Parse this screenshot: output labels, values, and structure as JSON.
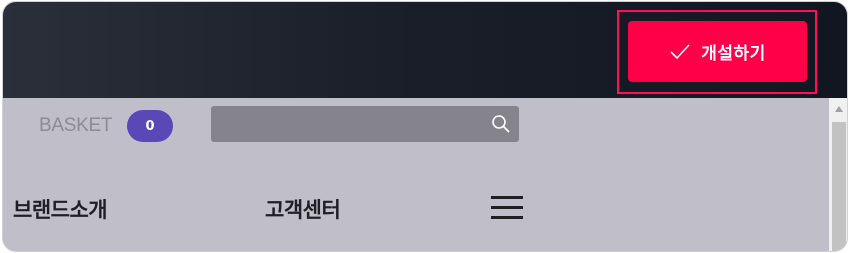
{
  "header": {
    "open_button_label": "개설하기",
    "open_button_icon": "check-icon",
    "accent_color": "#ff0048"
  },
  "basket": {
    "label": "BASKET",
    "count": "0",
    "badge_color": "#5b48b7"
  },
  "search": {
    "value": "",
    "placeholder": "",
    "icon": "search-icon"
  },
  "nav": {
    "items": [
      {
        "label": "브랜드소개"
      },
      {
        "label": "고객센터"
      }
    ],
    "menu_icon": "hamburger-menu-icon"
  }
}
